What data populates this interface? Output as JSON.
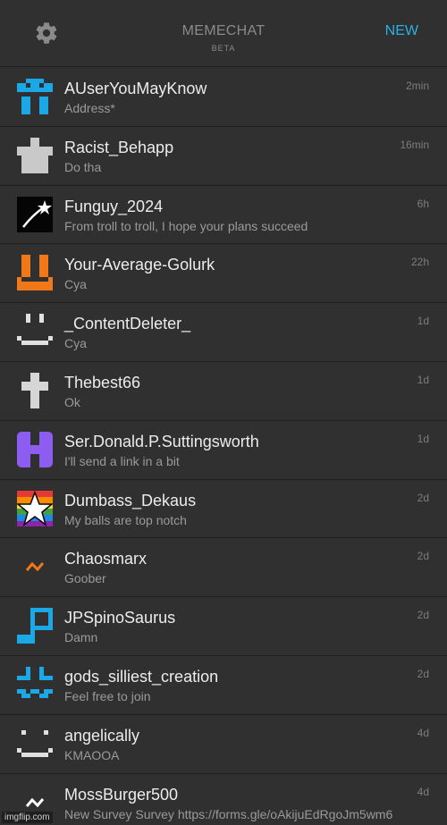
{
  "header": {
    "title": "MEMECHAT",
    "subtitle": "BETA",
    "new_label": "NEW",
    "settings_icon": "gear-icon"
  },
  "colors": {
    "accent": "#27b2e6",
    "background": "#303030",
    "divider": "#1f1f1f"
  },
  "chats": [
    {
      "name": "AUserYouMayKnow",
      "message": "Address*",
      "time": "2min",
      "avatar": "blue-pixel-face"
    },
    {
      "name": "Racist_Behapp",
      "message": "Do tha",
      "time": "16min",
      "avatar": "grey-block-figure"
    },
    {
      "name": "Funguy_2024",
      "message": "From troll to troll, I hope your plans succeed",
      "time": "6h",
      "avatar": "shooting-star"
    },
    {
      "name": "Your-Average-Golurk",
      "message": "Cya",
      "time": "22h",
      "avatar": "orange-pixel-face"
    },
    {
      "name": "_ContentDeleter_",
      "message": "Cya",
      "time": "1d",
      "avatar": "white-smiley-face"
    },
    {
      "name": "Thebest66",
      "message": "Ok",
      "time": "1d",
      "avatar": "cross"
    },
    {
      "name": "Ser.Donald.P.Suttingsworth",
      "message": "I'll send a link in a bit",
      "time": "1d",
      "avatar": "purple-h"
    },
    {
      "name": "Dumbass_Dekaus",
      "message": "My balls are top notch",
      "time": "2d",
      "avatar": "rainbow-star"
    },
    {
      "name": "Chaosmarx",
      "message": "Goober",
      "time": "2d",
      "avatar": "orange-squiggle"
    },
    {
      "name": "JPSpinoSaurus",
      "message": "Damn",
      "time": "2d",
      "avatar": "blue-p-shape"
    },
    {
      "name": "gods_silliest_creation",
      "message": "Feel free to join",
      "time": "2d",
      "avatar": "blue-smiley-face"
    },
    {
      "name": "angelically",
      "message": "KMAOOA",
      "time": "4d",
      "avatar": "white-smiley-face"
    },
    {
      "name": "MossBurger500",
      "message": "New Survey Survey https://forms.gle/oAkijuEdRgoJm5wm6",
      "time": "4d",
      "avatar": "white-squiggle"
    }
  ],
  "watermark": "imgflip.com"
}
